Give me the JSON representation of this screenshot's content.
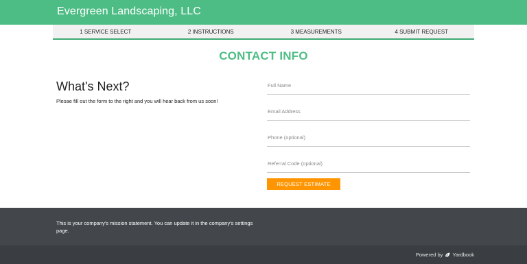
{
  "header": {
    "brand": "Evergreen Landscaping, LLC"
  },
  "steps": [
    {
      "label": "1 SERVICE SELECT"
    },
    {
      "label": "2 INSTRUCTIONS"
    },
    {
      "label": "3 MEASUREMENTS"
    },
    {
      "label": "4 SUBMIT REQUEST"
    }
  ],
  "contact": {
    "title": "CONTACT INFO"
  },
  "next": {
    "heading": "What's Next?",
    "text": "Plesae fill out the form to the right and you will hear back from us soon!"
  },
  "form": {
    "full_name": {
      "placeholder": "Full Name",
      "value": ""
    },
    "email": {
      "placeholder": "Email Address",
      "value": ""
    },
    "phone": {
      "placeholder": "Phone (optional)",
      "value": ""
    },
    "referral": {
      "placeholder": "Referral Code (optional)",
      "value": ""
    },
    "submit_label": "REQUEST ESTIMATE"
  },
  "footer": {
    "mission": "This is your company's mission statement. You can update it in the company's settings page.",
    "powered_by": "Powered by",
    "powered_brand": "Yardbook",
    "powered_icon": "leaf-icon"
  },
  "colors": {
    "brand_green": "#4dbd85",
    "accent_orange": "#ff9500",
    "footer_dark": "#43474b"
  }
}
